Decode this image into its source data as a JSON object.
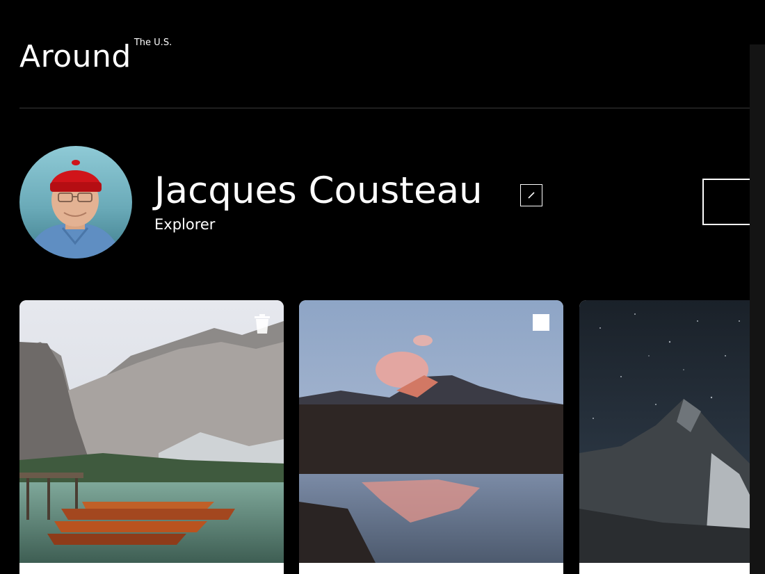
{
  "header": {
    "logo_main": "Around",
    "logo_super": "The U.S."
  },
  "profile": {
    "name": "Jacques Cousteau",
    "role": "Explorer"
  },
  "cards": [
    {
      "icon": "trash-icon"
    },
    {
      "icon": "like-icon"
    },
    {
      "icon": "none"
    }
  ],
  "colors": {
    "background": "#000000",
    "text": "#ffffff",
    "divider": "#3a3a3a",
    "card_footer": "#ffffff"
  }
}
